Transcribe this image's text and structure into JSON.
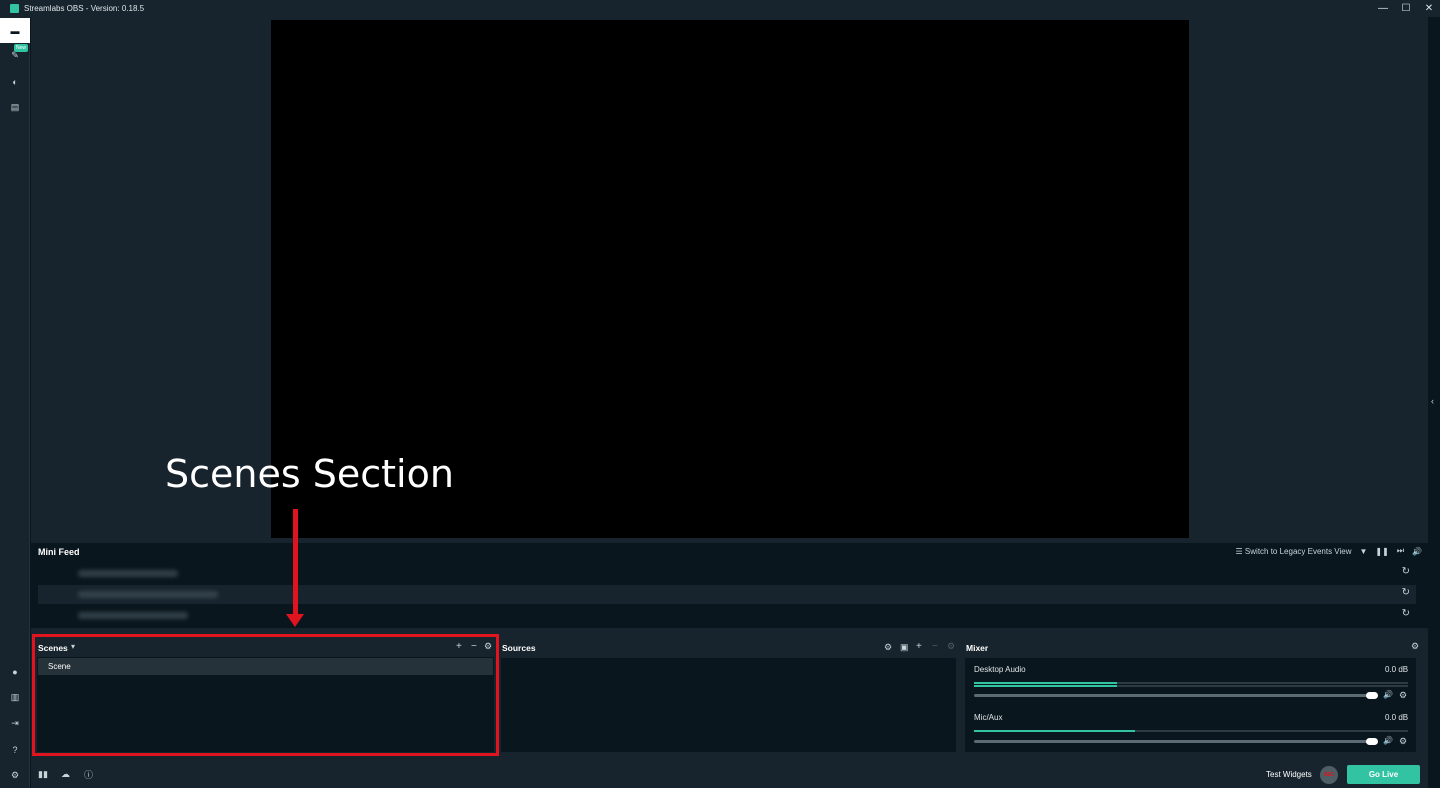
{
  "window": {
    "title": "Streamlabs OBS - Version: 0.18.5",
    "minimize": "—",
    "maximize": "☐",
    "close": "✕"
  },
  "sidebar": {
    "top_items": [
      {
        "name": "editor",
        "icon": "▬",
        "active": true
      },
      {
        "name": "themes",
        "icon": "✎",
        "badge": "New"
      },
      {
        "name": "live",
        "icon": "◐"
      },
      {
        "name": "store",
        "icon": "▤"
      }
    ],
    "bottom_items": [
      {
        "name": "highlighter",
        "icon": "●"
      },
      {
        "name": "layout",
        "icon": "▥"
      },
      {
        "name": "login",
        "icon": "⇥"
      },
      {
        "name": "help",
        "icon": "?"
      },
      {
        "name": "settings",
        "icon": "⚙"
      }
    ]
  },
  "minifeed": {
    "title": "Mini Feed",
    "legacy_toggle": "Switch to Legacy Events View",
    "tools": {
      "filter": "▼",
      "pause": "❚❚",
      "skip": "⏭",
      "volume": "🔊",
      "legacy_icon": "☰"
    },
    "refresh_icon": "↻"
  },
  "scenes": {
    "title": "Scenes",
    "dropdown_icon": "▾",
    "add": "+",
    "remove": "−",
    "settings": "⚙",
    "items": [
      "Scene"
    ]
  },
  "sources": {
    "title": "Sources",
    "add": "+",
    "remove": "−",
    "settings": "⚙",
    "folder": "▣",
    "gear": "⚙"
  },
  "mixer": {
    "title": "Mixer",
    "settings": "⚙",
    "channels": [
      {
        "label": "Desktop Audio",
        "db": "0.0 dB",
        "level": 0.33,
        "volume": 1.0
      },
      {
        "label": "Mic/Aux",
        "db": "0.0 dB",
        "level": 0.37,
        "volume": 1.0
      }
    ],
    "speaker_icon": "🔊",
    "gear_icon": "⚙"
  },
  "footer": {
    "stats_icon": "▮▮",
    "cloud_icon": "☁",
    "info_icon": "ⓘ",
    "test_widgets": "Test Widgets",
    "rec": "REC",
    "go_live": "Go Live"
  },
  "annotation": {
    "text": "Scenes Section"
  },
  "collapse_icon": "‹"
}
